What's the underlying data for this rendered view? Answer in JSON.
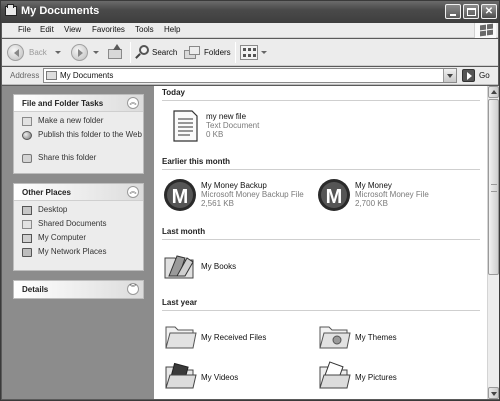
{
  "window": {
    "title": "My Documents"
  },
  "menu": [
    "File",
    "Edit",
    "View",
    "Favorites",
    "Tools",
    "Help"
  ],
  "toolbar": {
    "back_label": "Back",
    "search_label": "Search",
    "folders_label": "Folders"
  },
  "address": {
    "label": "Address",
    "value": "My Documents",
    "go_label": "Go"
  },
  "taskpane": {
    "file_tasks": {
      "title": "File and Folder Tasks",
      "items": [
        {
          "label": "Make a new folder",
          "icon": "new-folder-icon"
        },
        {
          "label": "Publish this folder to the Web",
          "icon": "globe-icon"
        },
        {
          "label": "Share this folder",
          "icon": "share-hand-icon"
        }
      ]
    },
    "other_places": {
      "title": "Other Places",
      "items": [
        {
          "label": "Desktop",
          "icon": "desktop-icon"
        },
        {
          "label": "Shared Documents",
          "icon": "folder-icon"
        },
        {
          "label": "My Computer",
          "icon": "computer-icon"
        },
        {
          "label": "My Network Places",
          "icon": "network-icon"
        }
      ]
    },
    "details": {
      "title": "Details"
    }
  },
  "groups": [
    {
      "title": "Today",
      "items": [
        {
          "name": "my new file",
          "type": "Text Document",
          "size": "0 KB",
          "icon": "text-document-icon"
        }
      ]
    },
    {
      "title": "Earlier this month",
      "items": [
        {
          "name": "My Money Backup",
          "type": "Microsoft Money Backup File",
          "size": "2,561 KB",
          "icon": "money-file-icon"
        },
        {
          "name": "My Money",
          "type": "Microsoft Money File",
          "size": "2,700 KB",
          "icon": "money-file-icon"
        }
      ]
    },
    {
      "title": "Last month",
      "items": [
        {
          "name": "My Books",
          "icon": "books-folder-icon"
        }
      ]
    },
    {
      "title": "Last year",
      "items": [
        {
          "name": "My Received Files",
          "icon": "folder-icon"
        },
        {
          "name": "My Themes",
          "icon": "themes-folder-icon"
        },
        {
          "name": "My Videos",
          "icon": "videos-folder-icon"
        },
        {
          "name": "My Pictures",
          "icon": "pictures-folder-icon"
        }
      ]
    }
  ]
}
